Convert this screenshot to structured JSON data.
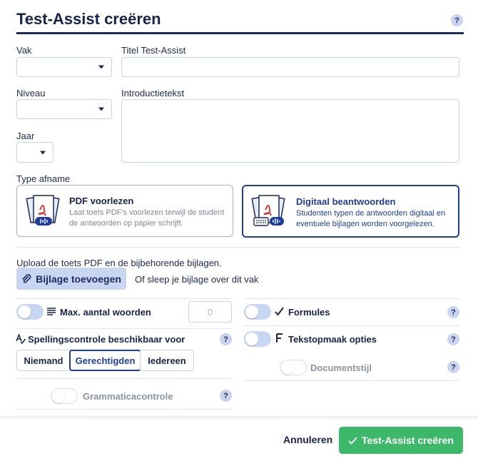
{
  "dialog": {
    "title": "Test-Assist creëren",
    "help_glyph": "?"
  },
  "form": {
    "vak_label": "Vak",
    "vak_value": "",
    "titel_label": "Titel Test-Assist",
    "titel_value": "",
    "niveau_label": "Niveau",
    "niveau_value": "",
    "intro_label": "Introductietekst",
    "intro_value": "",
    "jaar_label": "Jaar",
    "jaar_value": ""
  },
  "type_afname": {
    "label": "Type afname",
    "options": [
      {
        "title": "PDF voorlezen",
        "desc_line1": "Laat toets PDF's voorlezen terwijl de student",
        "desc_line2": "de antwoorden op papier schrijft.",
        "selected": false,
        "icon": "pdf-audio-icon"
      },
      {
        "title": "Digitaal beantwoorden",
        "desc_line1": "Studenten typen de antwoorden digitaal en",
        "desc_line2": "eventuele bijlagen worden voorgelezen.",
        "selected": true,
        "icon": "pdf-keyboard-icon"
      }
    ]
  },
  "upload": {
    "instruction": "Upload de toets PDF en de bijbehorende bijlagen.",
    "button_label": "Bijlage toevoegen",
    "drop_hint": "Of sleep je bijlage over dit vak"
  },
  "options": {
    "max_words_label": "Max. aantal woorden",
    "max_words_placeholder": "0",
    "max_words_on": false,
    "spelling_label": "Spellingscontrole beschikbaar voor",
    "spelling_choices": [
      "Niemand",
      "Gerechtigden",
      "Iedereen"
    ],
    "spelling_selected": "Gerechtigden",
    "grammar_label": "Grammaticacontrole",
    "grammar_on": false,
    "formules_label": "Formules",
    "formules_on": false,
    "tekstopmaak_label": "Tekstopmaak opties",
    "tekstopmaak_on": false,
    "documentstijl_label": "Documentstijl",
    "documentstijl_on": false
  },
  "footer": {
    "cancel_label": "Annuleren",
    "submit_label": "Test-Assist creëren"
  },
  "colors": {
    "primary": "#1f3d9b",
    "accent_green": "#3db86a",
    "toggle_off": "#c9d6f1"
  }
}
